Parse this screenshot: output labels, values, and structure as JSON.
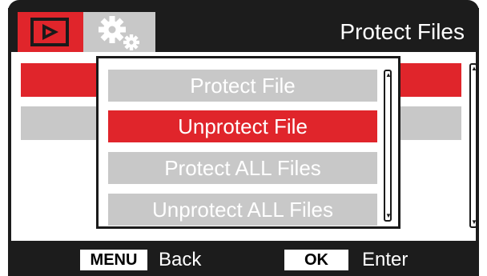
{
  "header": {
    "title": "Protect Files",
    "tabs": [
      {
        "icon": "playback-icon",
        "active": true
      },
      {
        "icon": "settings-gears-icon",
        "active": false
      }
    ]
  },
  "menu": {
    "items": [
      {
        "label": "Protect File",
        "selected": false
      },
      {
        "label": "Unprotect File",
        "selected": true
      },
      {
        "label": "Protect ALL Files",
        "selected": false
      },
      {
        "label": "Unprotect ALL Files",
        "selected": false
      }
    ]
  },
  "footer": {
    "menu_key": "MENU",
    "back_label": "Back",
    "ok_key": "OK",
    "enter_label": "Enter"
  },
  "colors": {
    "accent_red": "#e0252b",
    "item_gray": "#c8c8c8",
    "bar_black": "#1c1c1c"
  }
}
